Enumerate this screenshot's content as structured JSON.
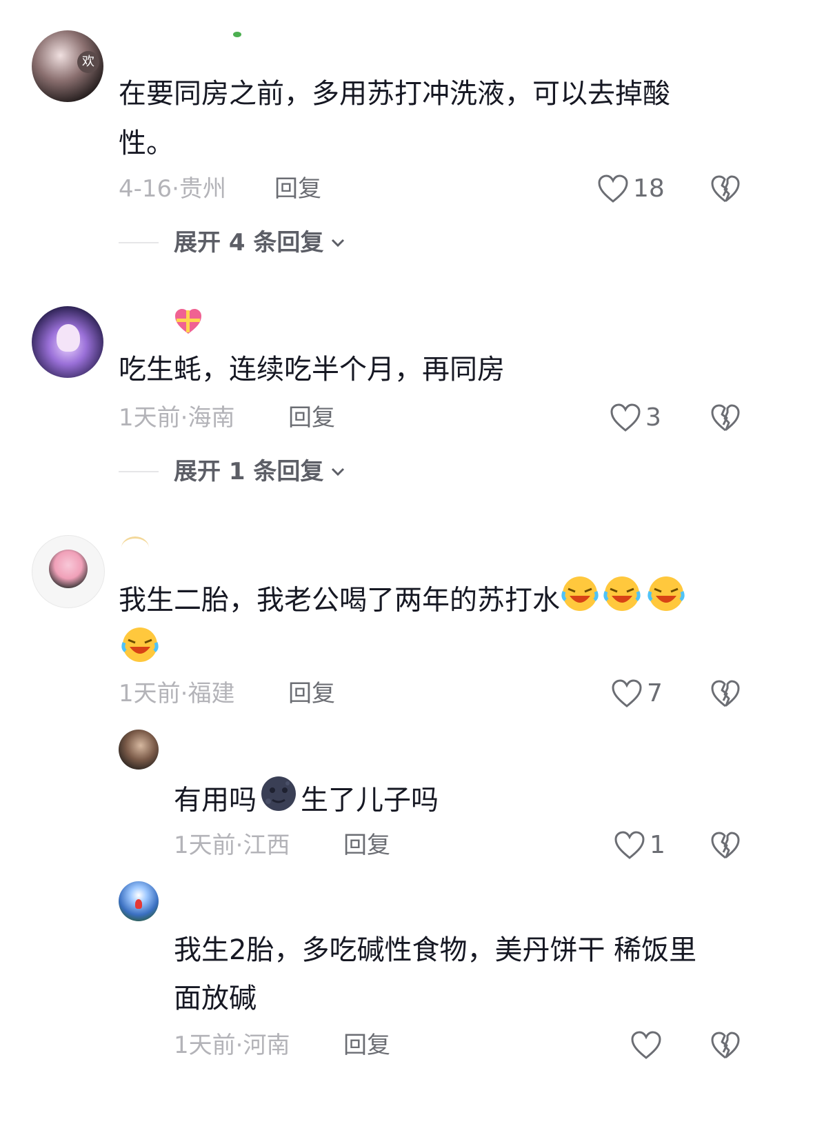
{
  "comments": [
    {
      "text_line1": "在要同房之前，多用苏打冲洗液，可以去掉酸",
      "text_line2": "性。",
      "date": "4-16",
      "location": "贵州",
      "reply_label": "回复",
      "likes": "18",
      "expand_label": "展开 4 条回复"
    },
    {
      "text_line1": "吃生蚝，连续吃半个月，再同房",
      "date": "1天前",
      "location": "海南",
      "reply_label": "回复",
      "likes": "3",
      "expand_label": "展开 1 条回复"
    },
    {
      "text_line1": "我生二胎，我老公喝了两年的苏打水",
      "date": "1天前",
      "location": "福建",
      "reply_label": "回复",
      "likes": "7",
      "emoji_name": "rofl-emoji",
      "replies": [
        {
          "text_part1": "有用吗",
          "text_part2": "生了儿子吗",
          "date": "1天前",
          "location": "江西",
          "reply_label": "回复",
          "likes": "1",
          "emoji_name": "new-moon-face-emoji"
        },
        {
          "text_line1": "我生2胎，多吃碱性食物，美丹饼干 稀饭里",
          "text_line2": "面放碱",
          "date": "1天前",
          "location": "河南",
          "reply_label": "回复",
          "likes": ""
        }
      ]
    }
  ],
  "separator": "·",
  "avatar_badge_1": "欢",
  "colors": {
    "text": "#161823",
    "meta": "#b3b3b8",
    "reply": "#6b6d73",
    "icon": "#6b6d73"
  }
}
